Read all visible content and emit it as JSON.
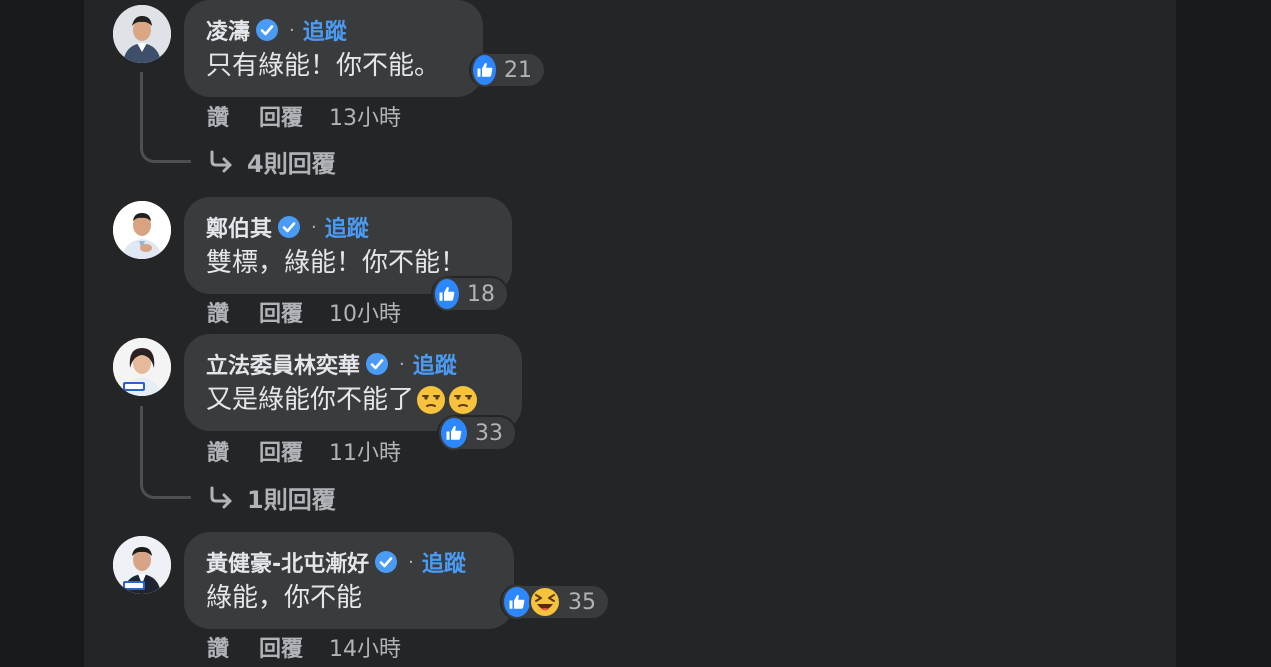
{
  "comments": [
    {
      "author": "凌濤",
      "follow_label": "追蹤",
      "separator": "·",
      "text": "只有綠能！你不能。",
      "reaction_count": "21",
      "actions": {
        "like": "讚",
        "reply": "回覆",
        "time": "13小時"
      },
      "replies_label": "4則回覆"
    },
    {
      "author": "鄭伯其",
      "follow_label": "追蹤",
      "separator": "·",
      "text": "雙標，綠能！你不能！",
      "reaction_count": "18",
      "actions": {
        "like": "讚",
        "reply": "回覆",
        "time": "10小時"
      }
    },
    {
      "author": "立法委員林奕華",
      "follow_label": "追蹤",
      "separator": "·",
      "text": "又是綠能你不能了",
      "text_emoji": "😒😒",
      "reaction_count": "33",
      "actions": {
        "like": "讚",
        "reply": "回覆",
        "time": "11小時"
      },
      "replies_label": "1則回覆"
    },
    {
      "author": "黃健豪-北屯漸好",
      "follow_label": "追蹤",
      "separator": "·",
      "text": "綠能，你不能",
      "reaction_count": "35",
      "actions": {
        "like": "讚",
        "reply": "回覆",
        "time": "14小時"
      }
    }
  ],
  "colors": {
    "page_bg": "#18191a",
    "feed_bg": "#242526",
    "bubble_bg": "#3a3b3c",
    "link_blue": "#4a9bf5",
    "like_blue": "#2d88ff",
    "muted_text": "#b0b3b8"
  },
  "icons": {
    "verified": "verified-badge-icon",
    "like": "like-thumb-icon",
    "haha": "haha-emoji-icon",
    "reply_arrow": "reply-arrow-icon"
  }
}
